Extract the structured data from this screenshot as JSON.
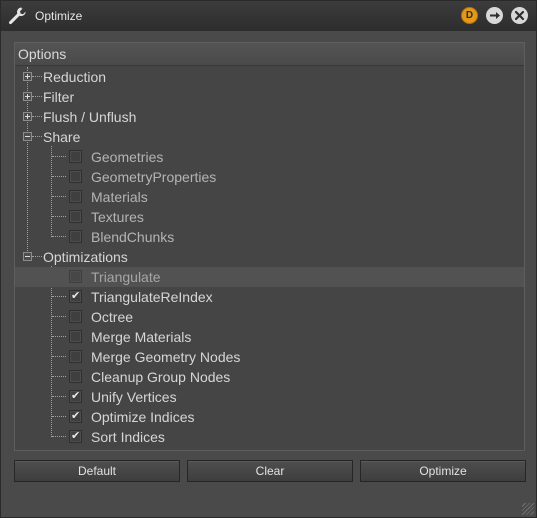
{
  "window": {
    "title": "Optimize"
  },
  "title_buttons": {
    "d_label": "D"
  },
  "panel": {
    "header": "Options"
  },
  "tree": {
    "groups": [
      {
        "label": "Reduction",
        "expanded": false
      },
      {
        "label": "Filter",
        "expanded": false
      },
      {
        "label": "Flush / Unflush",
        "expanded": false
      },
      {
        "label": "Share",
        "expanded": true,
        "children": [
          {
            "label": "Geometries",
            "checked": false
          },
          {
            "label": "GeometryProperties",
            "checked": false
          },
          {
            "label": "Materials",
            "checked": false
          },
          {
            "label": "Textures",
            "checked": false
          },
          {
            "label": "BlendChunks",
            "checked": false
          }
        ]
      },
      {
        "label": "Optimizations",
        "expanded": true,
        "children": [
          {
            "label": "Triangulate",
            "checked": false,
            "disabled": true,
            "selected": true
          },
          {
            "label": "TriangulateReIndex",
            "checked": true
          },
          {
            "label": "Octree",
            "checked": false
          },
          {
            "label": "Merge Materials",
            "checked": false
          },
          {
            "label": "Merge Geometry Nodes",
            "checked": false
          },
          {
            "label": "Cleanup Group Nodes",
            "checked": false
          },
          {
            "label": "Unify Vertices",
            "checked": true
          },
          {
            "label": "Optimize Indices",
            "checked": true
          },
          {
            "label": "Sort Indices",
            "checked": true
          }
        ]
      }
    ]
  },
  "buttons": {
    "default": "Default",
    "clear": "Clear",
    "optimize": "Optimize"
  },
  "icons": {
    "title": "wrench-icon",
    "d": "d-badge-icon",
    "arrow": "arrow-right-icon",
    "close": "close-icon"
  }
}
